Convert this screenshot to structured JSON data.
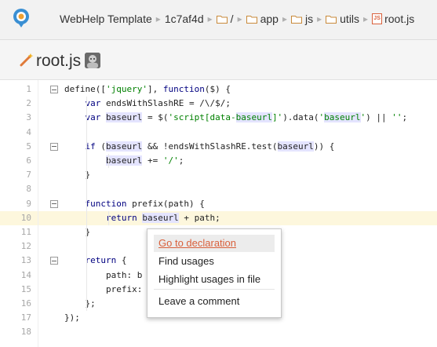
{
  "breadcrumb": [
    {
      "label": "WebHelp Template",
      "icon": ""
    },
    {
      "label": "1c7af4d",
      "icon": ""
    },
    {
      "label": "/",
      "icon": "folder-icon"
    },
    {
      "label": "app",
      "icon": "folder-icon"
    },
    {
      "label": "js",
      "icon": "folder-icon"
    },
    {
      "label": "utils",
      "icon": "folder-icon"
    },
    {
      "label": "root.js",
      "icon": "js-file-icon"
    }
  ],
  "file": {
    "name": "root.js",
    "icon": "magic-wand-icon"
  },
  "code": {
    "highlighted_line": 10,
    "lines": [
      {
        "n": "1",
        "fold": true,
        "text": "define(['jquery'], function($) {"
      },
      {
        "n": "2",
        "fold": false,
        "text": "    var endsWithSlashRE = /\\/$/;"
      },
      {
        "n": "3",
        "fold": false,
        "text": "    var baseurl = $('script[data-baseurl]').data('baseurl') || '';"
      },
      {
        "n": "4",
        "fold": false,
        "text": ""
      },
      {
        "n": "5",
        "fold": true,
        "text": "    if (baseurl && !endsWithSlashRE.test(baseurl)) {"
      },
      {
        "n": "6",
        "fold": false,
        "text": "        baseurl += '/';"
      },
      {
        "n": "7",
        "fold": false,
        "text": "    }"
      },
      {
        "n": "8",
        "fold": false,
        "text": ""
      },
      {
        "n": "9",
        "fold": true,
        "text": "    function prefix(path) {"
      },
      {
        "n": "10",
        "fold": false,
        "text": "        return baseurl + path;"
      },
      {
        "n": "11",
        "fold": false,
        "text": "    }"
      },
      {
        "n": "12",
        "fold": false,
        "text": ""
      },
      {
        "n": "13",
        "fold": true,
        "text": "    return {"
      },
      {
        "n": "14",
        "fold": false,
        "text": "        path: b"
      },
      {
        "n": "15",
        "fold": false,
        "text": "        prefix:"
      },
      {
        "n": "16",
        "fold": false,
        "text": "    };"
      },
      {
        "n": "17",
        "fold": false,
        "text": "});"
      },
      {
        "n": "18",
        "fold": false,
        "text": ""
      }
    ]
  },
  "context_menu": {
    "items": [
      {
        "label": "Go to declaration",
        "active": true
      },
      {
        "label": "Find usages",
        "active": false
      },
      {
        "label": "Highlight usages in file",
        "active": false
      },
      {
        "label": "Leave a comment",
        "active": false
      }
    ]
  },
  "colors": {
    "accent": "#d9603b",
    "keyword": "#000080",
    "string": "#008000",
    "highlight_line": "#fdf7dd"
  }
}
